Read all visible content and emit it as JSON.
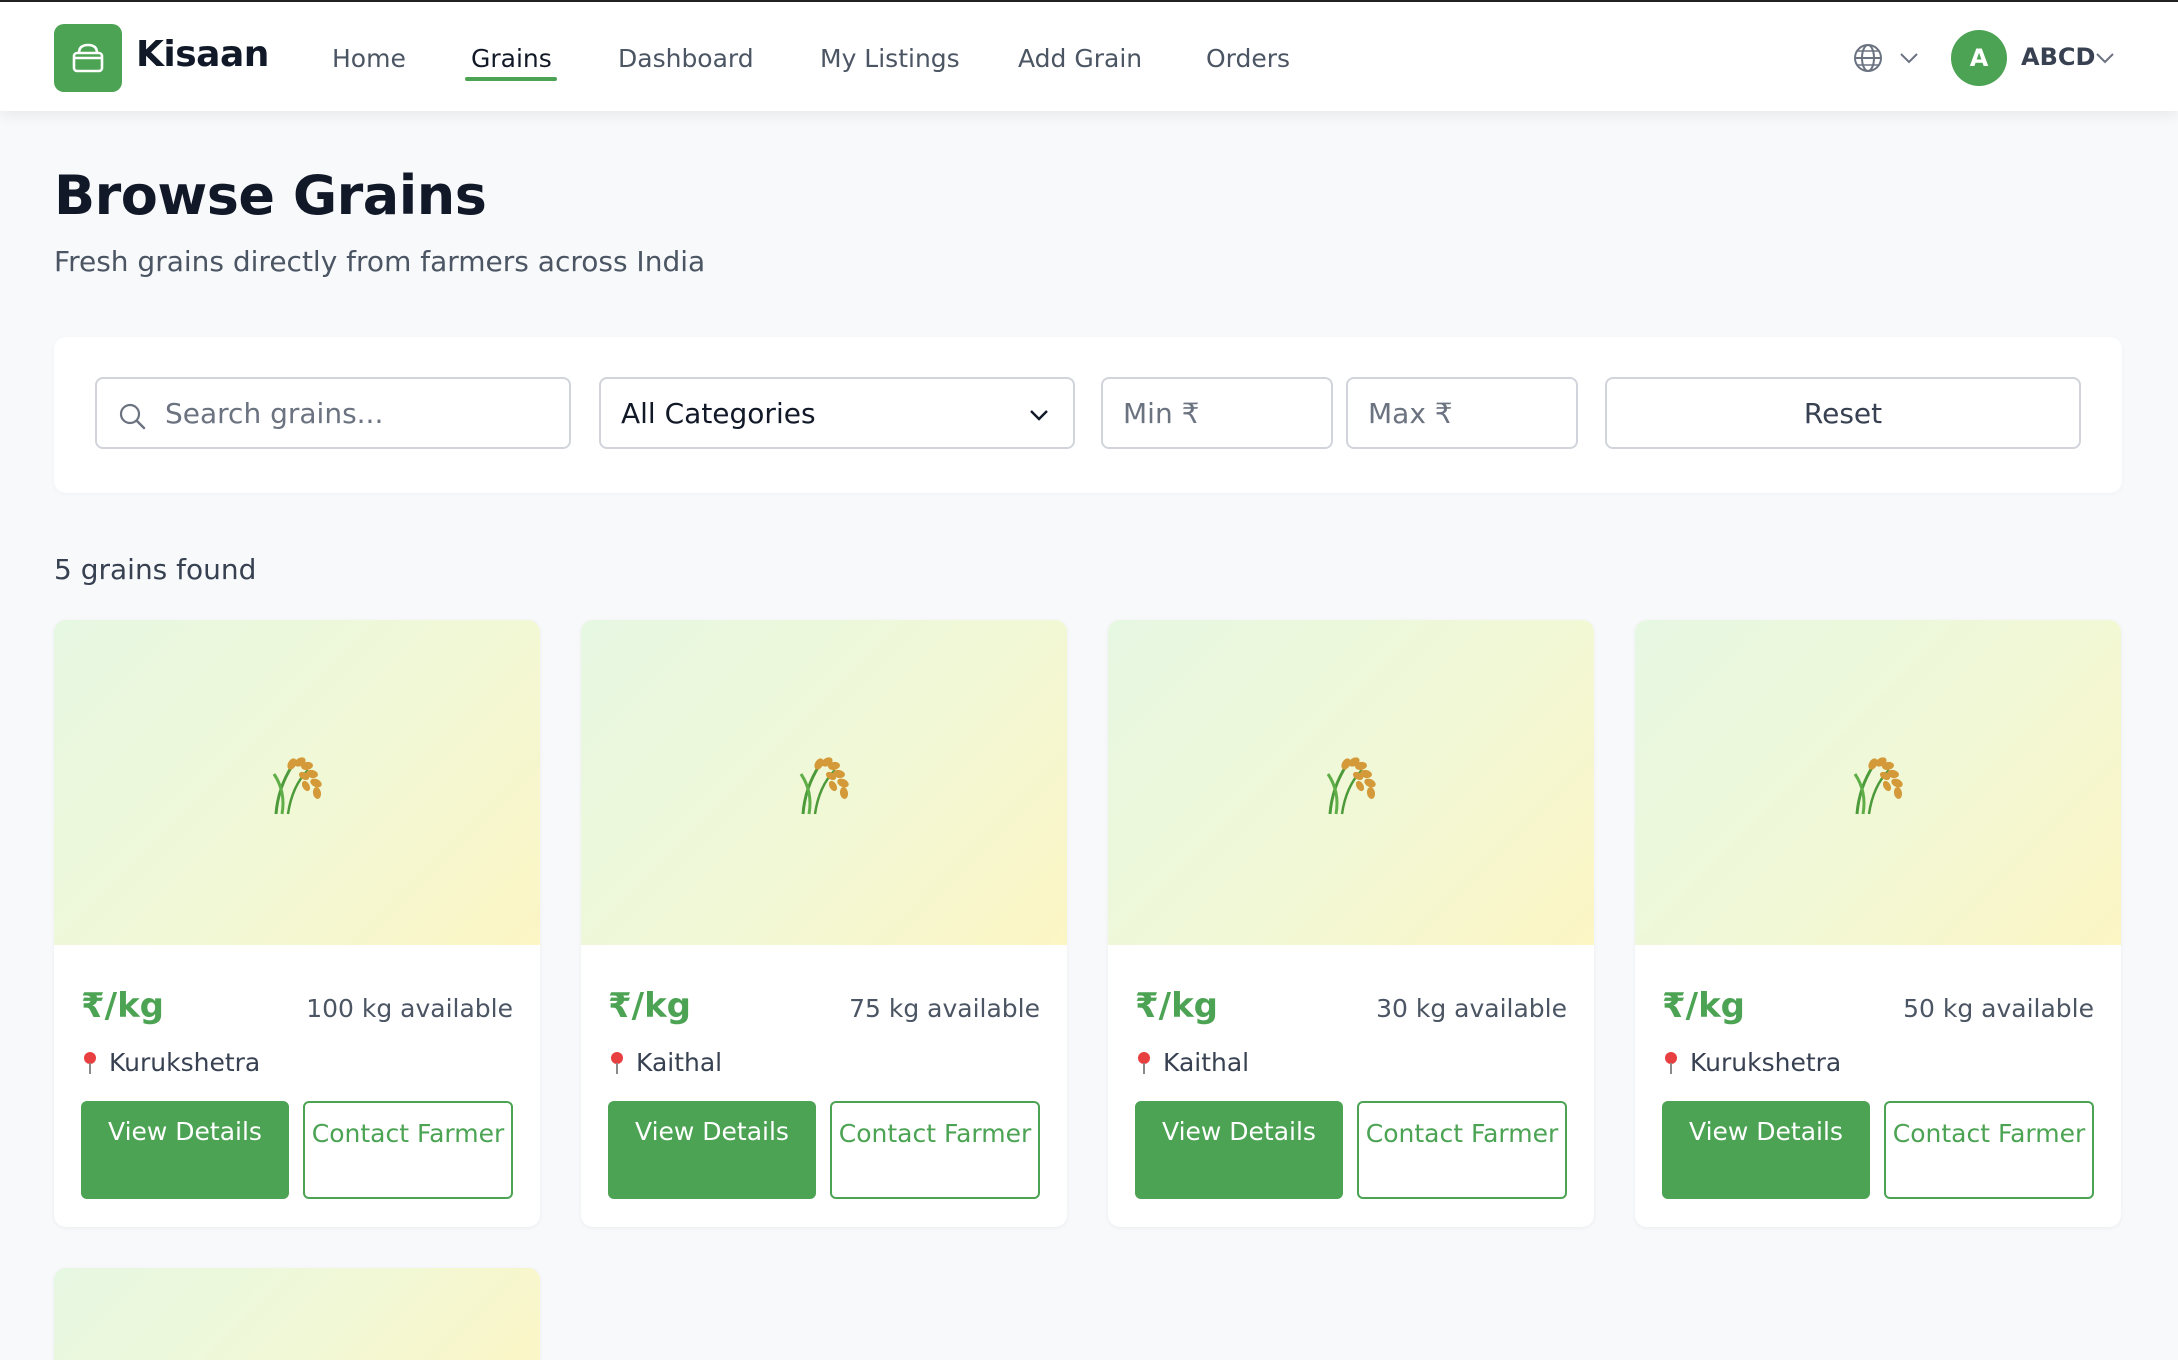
{
  "brand": {
    "name": "Kisaan",
    "accent": "#4ba353"
  },
  "nav": {
    "links": [
      {
        "label": "Home"
      },
      {
        "label": "Grains"
      },
      {
        "label": "Dashboard"
      },
      {
        "label": "My Listings"
      },
      {
        "label": "Add Grain"
      },
      {
        "label": "Orders"
      }
    ],
    "active": "Grains"
  },
  "user": {
    "initial": "A",
    "name": "ABCD"
  },
  "page": {
    "title": "Browse Grains",
    "subtitle": "Fresh grains directly from farmers across India"
  },
  "filters": {
    "search_placeholder": "Search grains...",
    "category_selected": "All Categories",
    "min_placeholder": "Min ₹",
    "max_placeholder": "Max ₹",
    "reset_label": "Reset"
  },
  "results": {
    "count_text": "5 grains found"
  },
  "cards": [
    {
      "price": "₹/kg",
      "available": "100 kg available",
      "location": "Kurukshetra",
      "view_label": "View Details",
      "contact_label": "Contact Farmer"
    },
    {
      "price": "₹/kg",
      "available": "75 kg available",
      "location": "Kaithal",
      "view_label": "View Details",
      "contact_label": "Contact Farmer"
    },
    {
      "price": "₹/kg",
      "available": "30 kg available",
      "location": "Kaithal",
      "view_label": "View Details",
      "contact_label": "Contact Farmer"
    },
    {
      "price": "₹/kg",
      "available": "50 kg available",
      "location": "Kurukshetra",
      "view_label": "View Details",
      "contact_label": "Contact Farmer"
    }
  ],
  "icons": {
    "logo": "basket-icon",
    "language": "globe-icon",
    "search": "search-icon",
    "grain": "rice-sheaf-icon",
    "location": "map-pin-icon"
  }
}
